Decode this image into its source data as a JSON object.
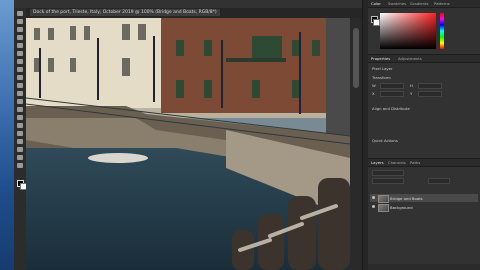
{
  "document": {
    "tab_title": "Dock of the port, Trieste, Italy, October 2019 @ 100% (Bridge and Boats, RGB/8*)"
  },
  "panels": {
    "color_tabs": [
      "Color",
      "Swatches",
      "Gradients",
      "Patterns"
    ],
    "properties_tabs": [
      "Properties",
      "Adjustments"
    ],
    "properties": {
      "section_pixel_layer": "Pixel Layer",
      "section_transform": "Transform",
      "w_label": "W",
      "h_label": "H",
      "x_label": "X",
      "y_label": "Y",
      "section_align": "Align and Distribute",
      "section_quick_actions": "Quick Actions"
    },
    "layers_tabs": [
      "Layers",
      "Channels",
      "Paths"
    ],
    "layers": [
      {
        "name": "Bridge and Boats"
      },
      {
        "name": "Background"
      }
    ]
  }
}
